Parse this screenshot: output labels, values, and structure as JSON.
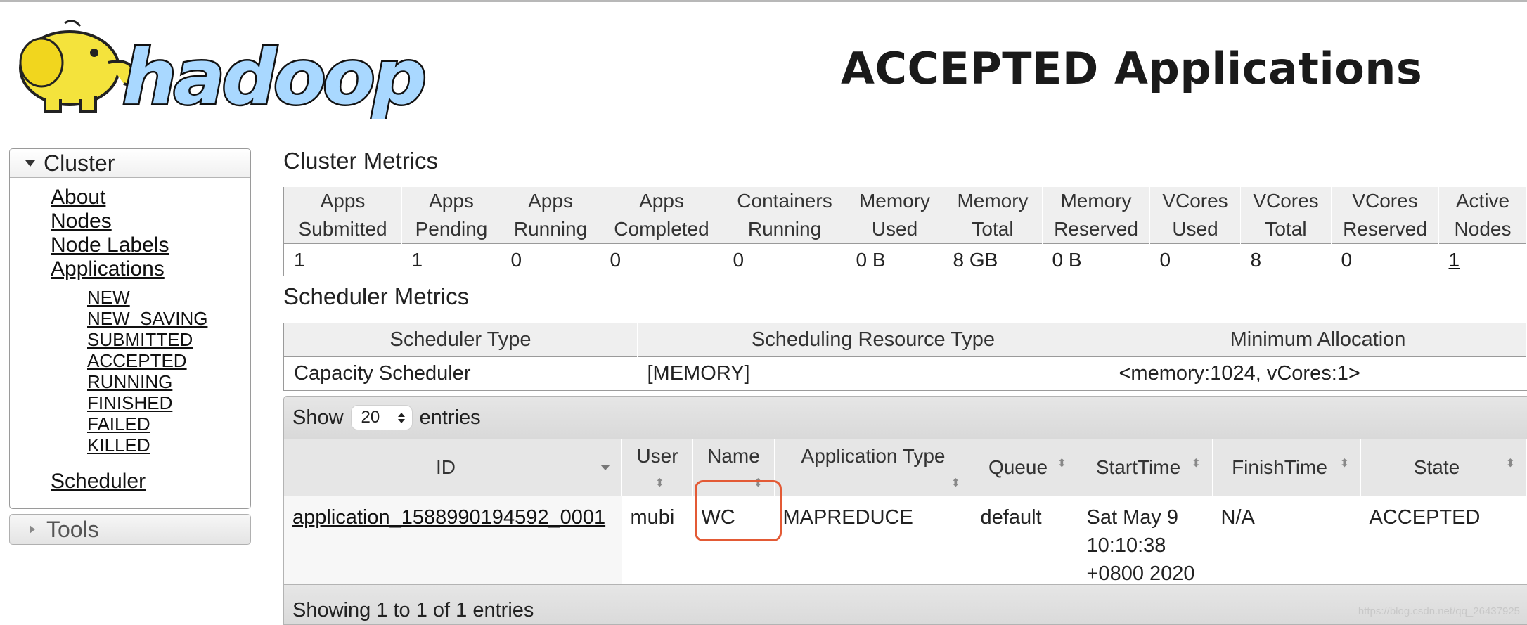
{
  "header": {
    "logo_text": "hadoop",
    "page_title": "ACCEPTED Applications"
  },
  "sidebar": {
    "cluster_title": "Cluster",
    "cluster_links": [
      "About",
      "Nodes",
      "Node Labels",
      "Applications"
    ],
    "app_states": [
      "NEW",
      "NEW_SAVING",
      "SUBMITTED",
      "ACCEPTED",
      "RUNNING",
      "FINISHED",
      "FAILED",
      "KILLED"
    ],
    "scheduler_link": "Scheduler",
    "tools_title": "Tools"
  },
  "cluster_metrics": {
    "title": "Cluster Metrics",
    "headers": [
      [
        "Apps",
        "Submitted"
      ],
      [
        "Apps",
        "Pending"
      ],
      [
        "Apps",
        "Running"
      ],
      [
        "Apps",
        "Completed"
      ],
      [
        "Containers",
        "Running"
      ],
      [
        "Memory",
        "Used"
      ],
      [
        "Memory",
        "Total"
      ],
      [
        "Memory",
        "Reserved"
      ],
      [
        "VCores",
        "Used"
      ],
      [
        "VCores",
        "Total"
      ],
      [
        "VCores",
        "Reserved"
      ],
      [
        "Active",
        "Nodes"
      ]
    ],
    "values": [
      "1",
      "1",
      "0",
      "0",
      "0",
      "0 B",
      "8 GB",
      "0 B",
      "0",
      "8",
      "0",
      "1"
    ]
  },
  "scheduler_metrics": {
    "title": "Scheduler Metrics",
    "headers": [
      "Scheduler Type",
      "Scheduling Resource Type",
      "Minimum Allocation"
    ],
    "values": [
      "Capacity Scheduler",
      "[MEMORY]",
      "<memory:1024, vCores:1>"
    ]
  },
  "apps": {
    "show_label": "Show",
    "entries_value": "20",
    "entries_label": "entries",
    "headers": [
      "ID",
      "User",
      "Name",
      "Application Type",
      "Queue",
      "StartTime",
      "FinishTime",
      "State"
    ],
    "rows": [
      {
        "id": "application_1588990194592_0001",
        "user": "mubi",
        "name": "WC",
        "type": "MAPREDUCE",
        "queue": "default",
        "start_lines": [
          "Sat May 9",
          "10:10:38",
          "+0800 2020"
        ],
        "finish": "N/A",
        "state": "ACCEPTED"
      }
    ],
    "footer": "Showing 1 to 1 of 1 entries"
  },
  "colors": {
    "highlight": "#e35a35",
    "header_bg": "#efefef"
  },
  "watermark": "https://blog.csdn.net/qq_26437925"
}
